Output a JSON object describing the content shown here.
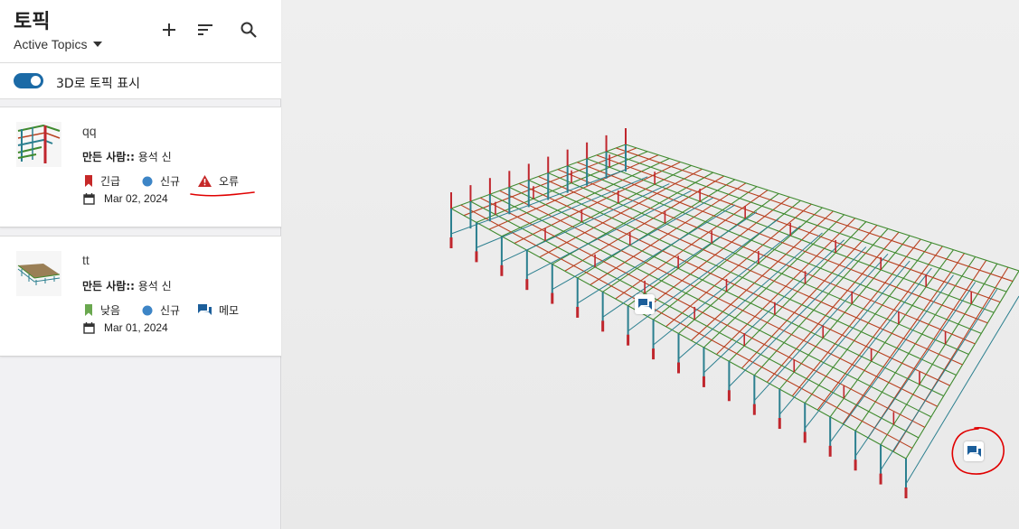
{
  "sidebar": {
    "title": "토픽",
    "filter_label": "Active Topics",
    "toggle_label": "3D로 토픽 표시",
    "toggle_on": true
  },
  "topics": [
    {
      "title": "qq",
      "creator_label": "만든 사람::",
      "creator_name": "용석 신",
      "priority": "긴급",
      "priority_color": "#c62828",
      "status": "신규",
      "status_color": "#3d85c6",
      "type": "오류",
      "type_icon": "warning-icon",
      "date": "Mar 02, 2024"
    },
    {
      "title": "tt",
      "creator_label": "만든 사람::",
      "creator_name": "용석 신",
      "priority": "낮음",
      "priority_color": "#6aa84f",
      "status": "신규",
      "status_color": "#3d85c6",
      "type": "메모",
      "type_icon": "comment-icon",
      "date": "Mar 01, 2024"
    }
  ],
  "colors": {
    "accent": "#1b6aa6",
    "beam_green": "#3f8a2e",
    "beam_red": "#b8401f",
    "column_teal": "#2b7f8f",
    "column_red": "#c0262d",
    "annotation_red": "#e00000"
  }
}
